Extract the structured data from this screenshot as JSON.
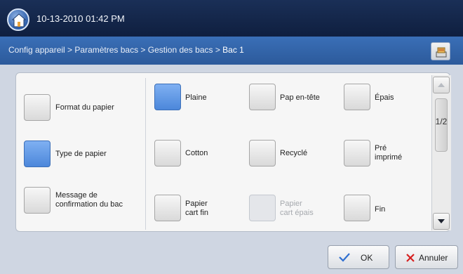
{
  "header": {
    "datetime": "10-13-2010 01:42 PM",
    "home_icon": "home-icon"
  },
  "breadcrumb": {
    "path": "Config appareil > Paramètres bacs > Gestion des bacs > ",
    "current": "Bac 1",
    "action_icon": "tray-settings-icon"
  },
  "left_options": [
    {
      "label": "Format du papier",
      "selected": false
    },
    {
      "label": "Type de papier",
      "selected": true
    },
    {
      "label_line1": "Message de",
      "label_line2": "confirmation du bac",
      "selected": false
    }
  ],
  "paper_types": {
    "plaine": "Plaine",
    "pap_entete": "Pap en-tête",
    "epais": "Épais",
    "cotton": "Cotton",
    "recycle": "Recyclé",
    "pre_imprime_1": "Pré",
    "pre_imprime_2": "imprimé",
    "cart_fin_1": "Papier",
    "cart_fin_2": "cart fin",
    "cart_epais_1": "Papier",
    "cart_epais_2": "cart épais",
    "fin": "Fin"
  },
  "pager": {
    "indicator": "1/2"
  },
  "footer": {
    "ok_label": "OK",
    "cancel_label": "Annuler"
  },
  "colors": {
    "selected": "#4c87da",
    "header": "#1a2f57",
    "breadcrumb_bar": "#2c5a9b",
    "cancel_x": "#d62020",
    "ok_check": "#2f6fd0"
  }
}
